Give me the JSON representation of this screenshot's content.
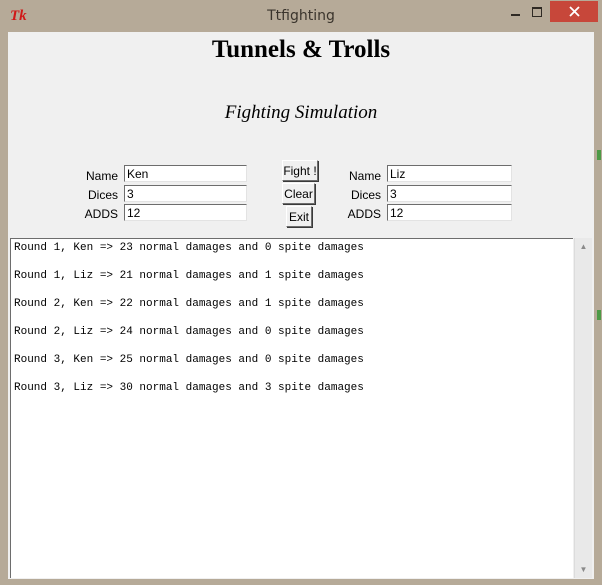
{
  "window": {
    "title": "Ttfighting",
    "icon_label": "Tk",
    "controls": [
      "minimize-icon",
      "maximize-icon",
      "close-icon"
    ],
    "close_color": "#c7473a"
  },
  "header": {
    "title": "Tunnels & Trolls",
    "subtitle": "Fighting Simulation"
  },
  "left_fighter": {
    "name_label": "Name",
    "name_value": "Ken",
    "dices_label": "Dices",
    "dices_value": "3",
    "adds_label": "ADDS",
    "adds_value": "12"
  },
  "right_fighter": {
    "name_label": "Name",
    "name_value": "Liz",
    "dices_label": "Dices",
    "dices_value": "3",
    "adds_label": "ADDS",
    "adds_value": "12"
  },
  "buttons": {
    "fight": "Fight !",
    "clear": "Clear",
    "exit": "Exit"
  },
  "output": {
    "lines": [
      "Round 1, Ken => 23 normal damages and 0 spite damages",
      "Round 1, Liz => 21 normal damages and 1 spite damages",
      "Round 2, Ken => 22 normal damages and 1 spite damages",
      "Round 2, Liz => 24 normal damages and 0 spite damages",
      "Round 3, Ken => 25 normal damages and 0 spite damages",
      "Round 3, Liz => 30 normal damages and 3 spite damages"
    ]
  },
  "scrollbar": {
    "up_icon": "scroll-up-arrow-icon",
    "down_icon": "scroll-down-arrow-icon"
  }
}
